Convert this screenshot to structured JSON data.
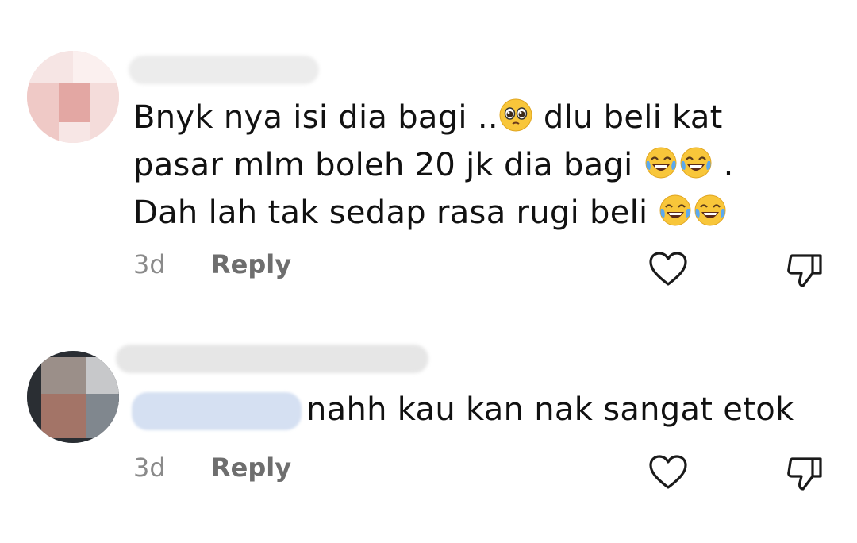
{
  "comments": [
    {
      "lines": [
        "Bnyk nya isi dia bagi ..",
        "pasar mlm boleh 20 jk dia bagi",
        "Dah lah tak sedap rasa rugi beli"
      ],
      "line1_tail": "dlu beli kat",
      "line2_tail": ".",
      "time": "3d",
      "reply_label": "Reply",
      "icons": {
        "like": "heart-outline-icon",
        "dislike": "thumbs-down-outline-icon"
      }
    },
    {
      "text": "nahh kau kan nak sangat etok",
      "time": "3d",
      "reply_label": "Reply",
      "icons": {
        "like": "heart-outline-icon",
        "dislike": "thumbs-down-outline-icon"
      }
    }
  ],
  "colors": {
    "text": "#111111",
    "muted": "#8a8a8a",
    "reply": "#6e6e6e",
    "mention": "#3b5ba9"
  }
}
